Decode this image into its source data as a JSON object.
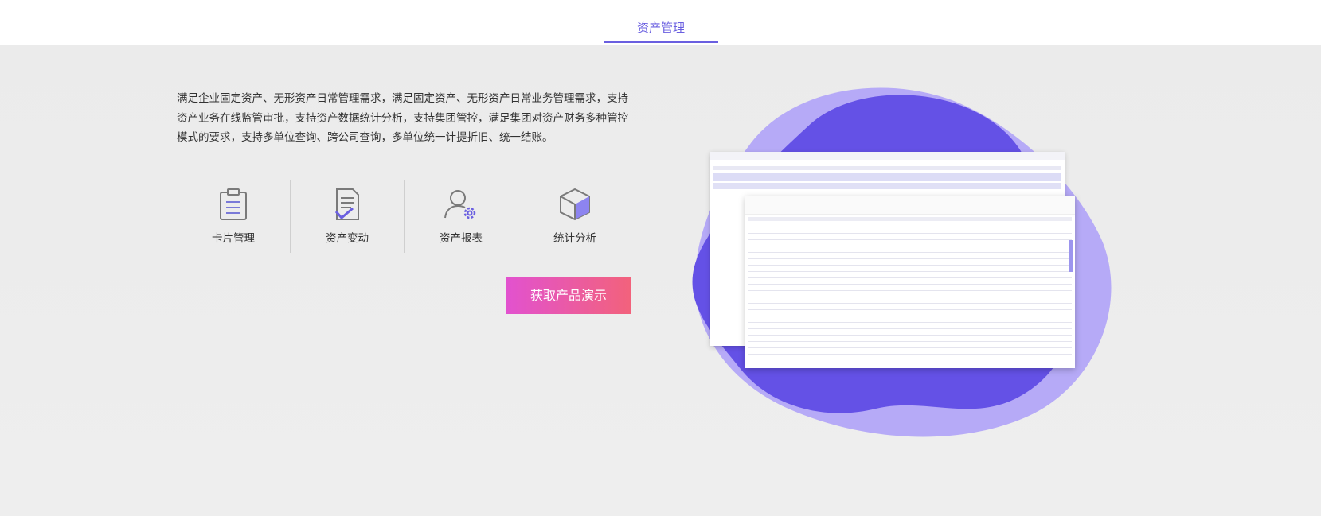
{
  "tab": {
    "label": "资产管理"
  },
  "description": "满足企业固定资产、无形资产日常管理需求，满足固定资产、无形资产日常业务管理需求，支持资产业务在线监管审批，支持资产数据统计分析，支持集团管控，满足集团对资产财务多种管控模式的要求，支持多单位查询、跨公司查询，多单位统一计提折旧、统一结账。",
  "features": [
    {
      "label": "卡片管理",
      "icon": "clipboard-icon"
    },
    {
      "label": "资产变动",
      "icon": "document-check-icon"
    },
    {
      "label": "资产报表",
      "icon": "user-settings-icon"
    },
    {
      "label": "统计分析",
      "icon": "cube-icon"
    }
  ],
  "cta": {
    "label": "获取产品演示"
  },
  "colors": {
    "accent": "#6a5fe0",
    "blob_dark": "#6451e6",
    "blob_light": "#b6aaf7",
    "cta_start": "#e252cf",
    "cta_end": "#f2627c"
  }
}
